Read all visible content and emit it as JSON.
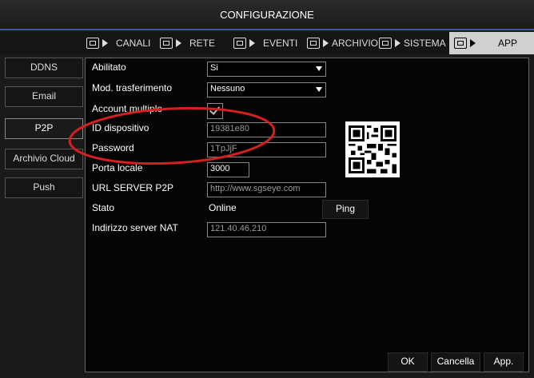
{
  "window": {
    "title": "CONFIGURAZIONE"
  },
  "tabs": [
    {
      "label": "CANALI",
      "icon": "camera-icon"
    },
    {
      "label": "RETE",
      "icon": "network-icon"
    },
    {
      "label": "EVENTI",
      "icon": "warning-icon"
    },
    {
      "label": "ARCHIVIO",
      "icon": "storage-icon"
    },
    {
      "label": "SISTEMA",
      "icon": "monitor-icon"
    },
    {
      "label": "APP",
      "icon": "app-icon",
      "active": true
    }
  ],
  "sidebar": {
    "items": [
      {
        "label": "DDNS"
      },
      {
        "label": "Email"
      },
      {
        "label": "P2P",
        "active": true
      },
      {
        "label": "Archivio Cloud"
      },
      {
        "label": "Push"
      }
    ]
  },
  "form": {
    "enabled": {
      "label": "Abilitato",
      "value": "Si"
    },
    "transfer_mode": {
      "label": "Mod. trasferimento",
      "value": "Nessuno"
    },
    "multi_account": {
      "label": "Account multiplo",
      "checked": true
    },
    "device_id": {
      "label": "ID dispositivo",
      "value": "19381e80"
    },
    "password": {
      "label": "Password",
      "value": "1TpJjF"
    },
    "local_port": {
      "label": "Porta locale",
      "value": "3000"
    },
    "server_url": {
      "label": "URL SERVER P2P",
      "value": "http://www.sgseye.com"
    },
    "status": {
      "label": "Stato",
      "value": "Online"
    },
    "nat_server": {
      "label": "Indirizzo server NAT",
      "value": "121.40.46.210"
    }
  },
  "buttons": {
    "ping": "Ping",
    "ok": "OK",
    "cancel": "Cancella",
    "apply": "App."
  },
  "colors": {
    "title_border": "#3c5a9a",
    "annotation": "#d42020",
    "panel_bg": "#050505"
  }
}
